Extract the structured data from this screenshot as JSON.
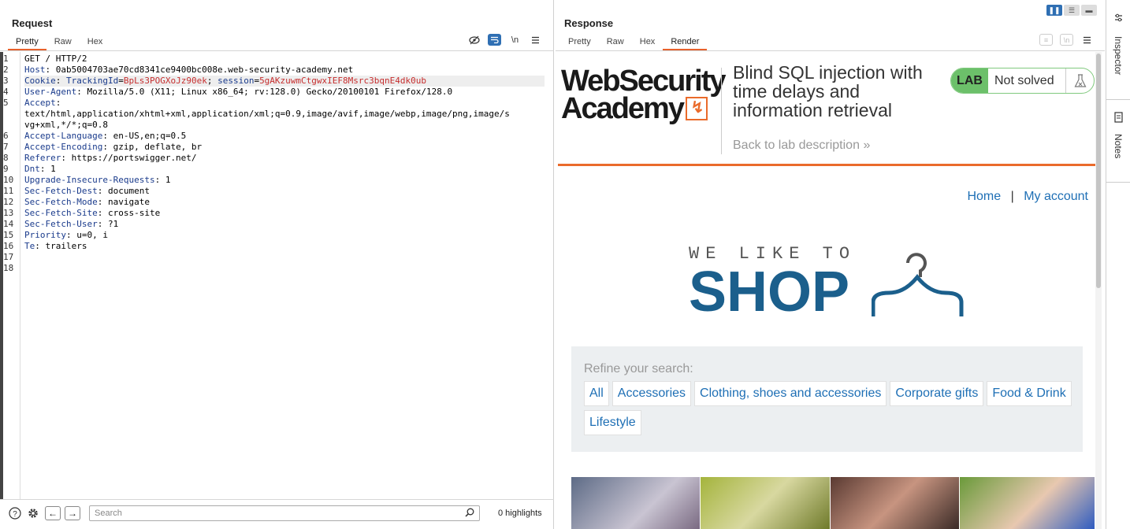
{
  "request": {
    "title": "Request",
    "tabs": [
      "Pretty",
      "Raw",
      "Hex"
    ],
    "active_tab": "Pretty",
    "lines": [
      {
        "n": "1",
        "text": "GET / HTTP/2"
      },
      {
        "n": "2",
        "key": "Host",
        "val": "0ab5004703ae70cd8341ce9400bc008e.web-security-academy.net"
      },
      {
        "n": "3",
        "cookie": true,
        "key": "Cookie",
        "c1k": "TrackingId",
        "c1v": "BpLs3POGXoJz90ek",
        "c2k": "session",
        "c2v": "5gAKzuwmCtgwxIEF8Msrc3bqnE4dk0ub"
      },
      {
        "n": "4",
        "key": "User-Agent",
        "val": "Mozilla/5.0 (X11; Linux x86_64; rv:128.0) Gecko/20100101 Firefox/128.0"
      },
      {
        "n": "5",
        "key": "Accept",
        "val": ""
      },
      {
        "n": "",
        "text": "text/html,application/xhtml+xml,application/xml;q=0.9,image/avif,image/webp,image/png,image/s"
      },
      {
        "n": "",
        "text": "vg+xml,*/*;q=0.8"
      },
      {
        "n": "6",
        "key": "Accept-Language",
        "val": "en-US,en;q=0.5"
      },
      {
        "n": "7",
        "key": "Accept-Encoding",
        "val": "gzip, deflate, br"
      },
      {
        "n": "8",
        "key": "Referer",
        "val": "https://portswigger.net/"
      },
      {
        "n": "9",
        "key": "Dnt",
        "val": "1"
      },
      {
        "n": "10",
        "key": "Upgrade-Insecure-Requests",
        "val": "1"
      },
      {
        "n": "11",
        "key": "Sec-Fetch-Dest",
        "val": "document"
      },
      {
        "n": "12",
        "key": "Sec-Fetch-Mode",
        "val": "navigate"
      },
      {
        "n": "13",
        "key": "Sec-Fetch-Site",
        "val": "cross-site"
      },
      {
        "n": "14",
        "key": "Sec-Fetch-User",
        "val": "?1"
      },
      {
        "n": "15",
        "key": "Priority",
        "val": "u=0, i"
      },
      {
        "n": "16",
        "key": "Te",
        "val": "trailers"
      },
      {
        "n": "17",
        "text": ""
      },
      {
        "n": "18",
        "text": ""
      }
    ],
    "search_placeholder": "Search",
    "highlights": "0 highlights"
  },
  "response": {
    "title": "Response",
    "tabs": [
      "Pretty",
      "Raw",
      "Hex",
      "Render"
    ],
    "active_tab": "Render",
    "page": {
      "logo_line1": "WebSecurity",
      "logo_line2": "Academy",
      "lab_title": "Blind SQL injection with time delays and information retrieval",
      "back_link": "Back to lab description",
      "lab_badge": "LAB",
      "lab_status": "Not solved",
      "nav_home": "Home",
      "nav_sep": "|",
      "nav_account": "My account",
      "shop_small": "WE LIKE TO",
      "shop_big": "SHOP",
      "refine_label": "Refine your search:",
      "categories": [
        "All",
        "Accessories",
        "Clothing, shoes and accessories",
        "Corporate gifts",
        "Food & Drink",
        "Lifestyle"
      ]
    }
  },
  "sidebar": {
    "inspector": "Inspector",
    "notes": "Notes"
  },
  "colors": {
    "accent": "#e8612c",
    "link": "#1e6fb5",
    "lab_green": "#6cc06a",
    "shop_blue": "#1b5f8c"
  }
}
